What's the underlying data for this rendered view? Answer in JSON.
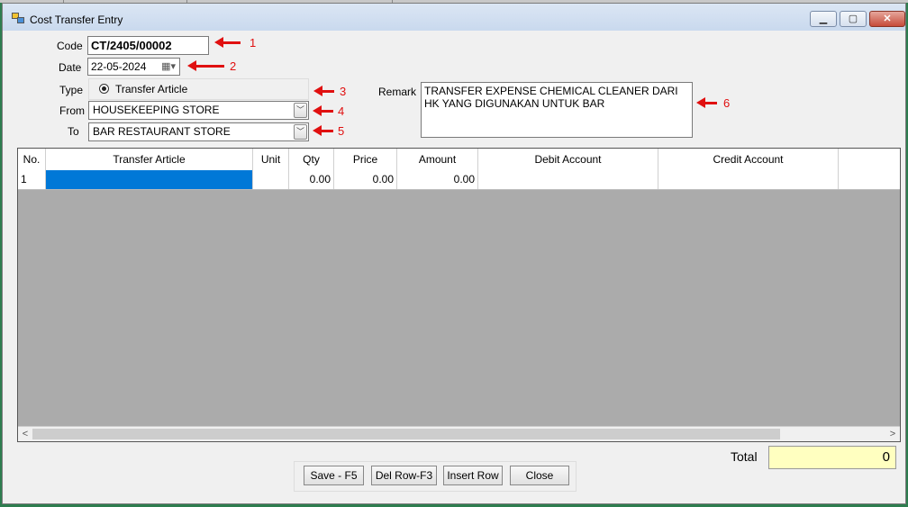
{
  "window": {
    "title": "Cost Transfer Entry",
    "minimize": "▁",
    "maximize": "▢",
    "close": "✕"
  },
  "form": {
    "code_label": "Code",
    "code_value": "CT/2405/00002",
    "date_label": "Date",
    "date_value": "22-05-2024",
    "type_label": "Type",
    "type_option": "Transfer Article",
    "from_label": "From",
    "from_value": "HOUSEKEEPING STORE",
    "to_label": "To",
    "to_value": "BAR RESTAURANT STORE",
    "remark_label": "Remark",
    "remark_value": "TRANSFER EXPENSE CHEMICAL CLEANER DARI HK YANG DIGUNAKAN UNTUK BAR"
  },
  "annotations": [
    "1",
    "2",
    "3",
    "4",
    "5",
    "6"
  ],
  "grid": {
    "columns": [
      "No.",
      "Transfer Article",
      "Unit",
      "Qty",
      "Price",
      "Amount",
      "Debit Account",
      "Credit Account"
    ],
    "rows": [
      {
        "no": "1",
        "article": "",
        "unit": "",
        "qty": "0.00",
        "price": "0.00",
        "amount": "0.00",
        "debit": "",
        "credit": ""
      }
    ]
  },
  "total": {
    "label": "Total",
    "value": "0"
  },
  "buttons": {
    "save": "Save - F5",
    "delrow": "Del Row-F3",
    "insert": "Insert Row",
    "close": "Close"
  },
  "colors": {
    "selection": "#0078d7",
    "annotation": "#e01010",
    "total_bg": "#ffffc0"
  }
}
